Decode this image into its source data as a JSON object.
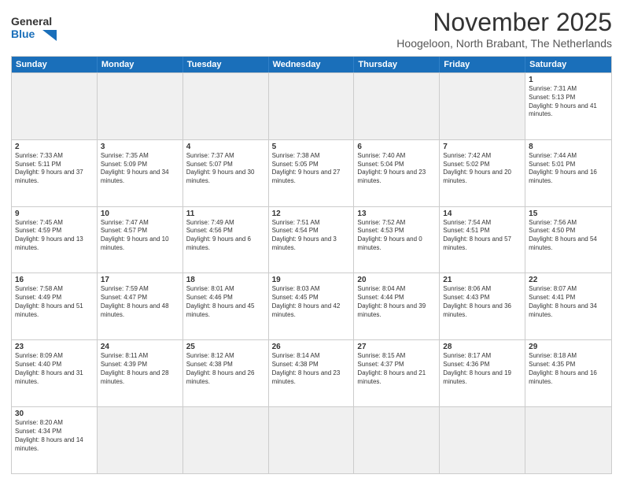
{
  "header": {
    "logo_general": "General",
    "logo_blue": "Blue",
    "month_title": "November 2025",
    "subtitle": "Hoogeloon, North Brabant, The Netherlands"
  },
  "weekdays": [
    "Sunday",
    "Monday",
    "Tuesday",
    "Wednesday",
    "Thursday",
    "Friday",
    "Saturday"
  ],
  "weeks": [
    [
      {
        "day": "",
        "empty": true
      },
      {
        "day": "",
        "empty": true
      },
      {
        "day": "",
        "empty": true
      },
      {
        "day": "",
        "empty": true
      },
      {
        "day": "",
        "empty": true
      },
      {
        "day": "",
        "empty": true
      },
      {
        "day": "1",
        "sunrise": "Sunrise: 7:31 AM",
        "sunset": "Sunset: 5:13 PM",
        "daylight": "Daylight: 9 hours and 41 minutes."
      }
    ],
    [
      {
        "day": "2",
        "sunrise": "Sunrise: 7:33 AM",
        "sunset": "Sunset: 5:11 PM",
        "daylight": "Daylight: 9 hours and 37 minutes."
      },
      {
        "day": "3",
        "sunrise": "Sunrise: 7:35 AM",
        "sunset": "Sunset: 5:09 PM",
        "daylight": "Daylight: 9 hours and 34 minutes."
      },
      {
        "day": "4",
        "sunrise": "Sunrise: 7:37 AM",
        "sunset": "Sunset: 5:07 PM",
        "daylight": "Daylight: 9 hours and 30 minutes."
      },
      {
        "day": "5",
        "sunrise": "Sunrise: 7:38 AM",
        "sunset": "Sunset: 5:05 PM",
        "daylight": "Daylight: 9 hours and 27 minutes."
      },
      {
        "day": "6",
        "sunrise": "Sunrise: 7:40 AM",
        "sunset": "Sunset: 5:04 PM",
        "daylight": "Daylight: 9 hours and 23 minutes."
      },
      {
        "day": "7",
        "sunrise": "Sunrise: 7:42 AM",
        "sunset": "Sunset: 5:02 PM",
        "daylight": "Daylight: 9 hours and 20 minutes."
      },
      {
        "day": "8",
        "sunrise": "Sunrise: 7:44 AM",
        "sunset": "Sunset: 5:01 PM",
        "daylight": "Daylight: 9 hours and 16 minutes."
      }
    ],
    [
      {
        "day": "9",
        "sunrise": "Sunrise: 7:45 AM",
        "sunset": "Sunset: 4:59 PM",
        "daylight": "Daylight: 9 hours and 13 minutes."
      },
      {
        "day": "10",
        "sunrise": "Sunrise: 7:47 AM",
        "sunset": "Sunset: 4:57 PM",
        "daylight": "Daylight: 9 hours and 10 minutes."
      },
      {
        "day": "11",
        "sunrise": "Sunrise: 7:49 AM",
        "sunset": "Sunset: 4:56 PM",
        "daylight": "Daylight: 9 hours and 6 minutes."
      },
      {
        "day": "12",
        "sunrise": "Sunrise: 7:51 AM",
        "sunset": "Sunset: 4:54 PM",
        "daylight": "Daylight: 9 hours and 3 minutes."
      },
      {
        "day": "13",
        "sunrise": "Sunrise: 7:52 AM",
        "sunset": "Sunset: 4:53 PM",
        "daylight": "Daylight: 9 hours and 0 minutes."
      },
      {
        "day": "14",
        "sunrise": "Sunrise: 7:54 AM",
        "sunset": "Sunset: 4:51 PM",
        "daylight": "Daylight: 8 hours and 57 minutes."
      },
      {
        "day": "15",
        "sunrise": "Sunrise: 7:56 AM",
        "sunset": "Sunset: 4:50 PM",
        "daylight": "Daylight: 8 hours and 54 minutes."
      }
    ],
    [
      {
        "day": "16",
        "sunrise": "Sunrise: 7:58 AM",
        "sunset": "Sunset: 4:49 PM",
        "daylight": "Daylight: 8 hours and 51 minutes."
      },
      {
        "day": "17",
        "sunrise": "Sunrise: 7:59 AM",
        "sunset": "Sunset: 4:47 PM",
        "daylight": "Daylight: 8 hours and 48 minutes."
      },
      {
        "day": "18",
        "sunrise": "Sunrise: 8:01 AM",
        "sunset": "Sunset: 4:46 PM",
        "daylight": "Daylight: 8 hours and 45 minutes."
      },
      {
        "day": "19",
        "sunrise": "Sunrise: 8:03 AM",
        "sunset": "Sunset: 4:45 PM",
        "daylight": "Daylight: 8 hours and 42 minutes."
      },
      {
        "day": "20",
        "sunrise": "Sunrise: 8:04 AM",
        "sunset": "Sunset: 4:44 PM",
        "daylight": "Daylight: 8 hours and 39 minutes."
      },
      {
        "day": "21",
        "sunrise": "Sunrise: 8:06 AM",
        "sunset": "Sunset: 4:43 PM",
        "daylight": "Daylight: 8 hours and 36 minutes."
      },
      {
        "day": "22",
        "sunrise": "Sunrise: 8:07 AM",
        "sunset": "Sunset: 4:41 PM",
        "daylight": "Daylight: 8 hours and 34 minutes."
      }
    ],
    [
      {
        "day": "23",
        "sunrise": "Sunrise: 8:09 AM",
        "sunset": "Sunset: 4:40 PM",
        "daylight": "Daylight: 8 hours and 31 minutes."
      },
      {
        "day": "24",
        "sunrise": "Sunrise: 8:11 AM",
        "sunset": "Sunset: 4:39 PM",
        "daylight": "Daylight: 8 hours and 28 minutes."
      },
      {
        "day": "25",
        "sunrise": "Sunrise: 8:12 AM",
        "sunset": "Sunset: 4:38 PM",
        "daylight": "Daylight: 8 hours and 26 minutes."
      },
      {
        "day": "26",
        "sunrise": "Sunrise: 8:14 AM",
        "sunset": "Sunset: 4:38 PM",
        "daylight": "Daylight: 8 hours and 23 minutes."
      },
      {
        "day": "27",
        "sunrise": "Sunrise: 8:15 AM",
        "sunset": "Sunset: 4:37 PM",
        "daylight": "Daylight: 8 hours and 21 minutes."
      },
      {
        "day": "28",
        "sunrise": "Sunrise: 8:17 AM",
        "sunset": "Sunset: 4:36 PM",
        "daylight": "Daylight: 8 hours and 19 minutes."
      },
      {
        "day": "29",
        "sunrise": "Sunrise: 8:18 AM",
        "sunset": "Sunset: 4:35 PM",
        "daylight": "Daylight: 8 hours and 16 minutes."
      }
    ],
    [
      {
        "day": "30",
        "sunrise": "Sunrise: 8:20 AM",
        "sunset": "Sunset: 4:34 PM",
        "daylight": "Daylight: 8 hours and 14 minutes."
      },
      {
        "day": "",
        "empty": true
      },
      {
        "day": "",
        "empty": true
      },
      {
        "day": "",
        "empty": true
      },
      {
        "day": "",
        "empty": true
      },
      {
        "day": "",
        "empty": true
      },
      {
        "day": "",
        "empty": true
      }
    ]
  ]
}
